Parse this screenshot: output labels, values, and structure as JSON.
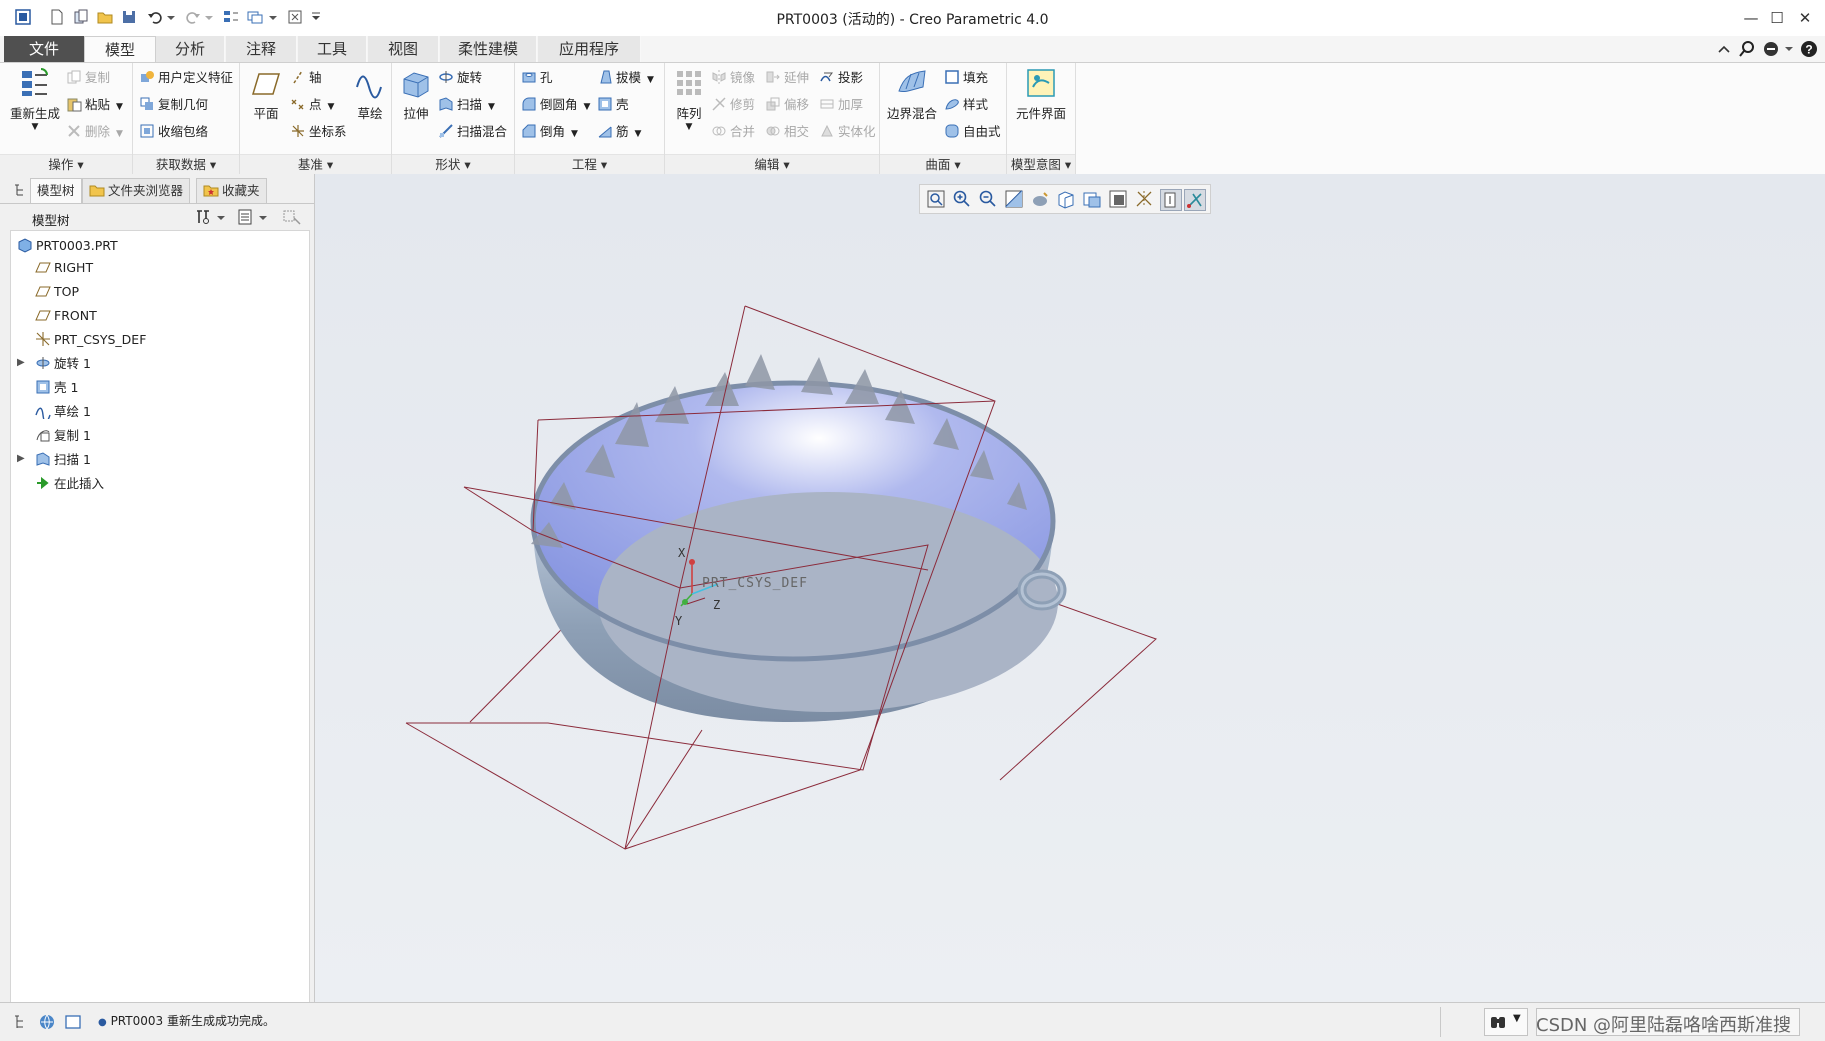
{
  "window": {
    "title": "PRT0003 (活动的) - Creo Parametric 4.0",
    "controls": [
      "—",
      "☐",
      "✕"
    ]
  },
  "tabs": [
    {
      "label": "文件"
    },
    {
      "label": "模型"
    },
    {
      "label": "分析"
    },
    {
      "label": "注释"
    },
    {
      "label": "工具"
    },
    {
      "label": "视图"
    },
    {
      "label": "柔性建模"
    },
    {
      "label": "应用程序"
    }
  ],
  "ribbon": {
    "operations": {
      "label": "操作",
      "regenerate": "重新生成",
      "copy": "复制",
      "paste": "粘贴",
      "delete": "删除"
    },
    "get_data": {
      "label": "获取数据",
      "udf": "用户定义特征",
      "copy_geom": "复制几何",
      "shrinkwrap": "收缩包络"
    },
    "datum": {
      "label": "基准",
      "plane": "平面",
      "axis": "轴",
      "point": "点",
      "csys": "坐标系",
      "sketch": "草绘"
    },
    "shapes": {
      "label": "形状",
      "extrude": "拉伸",
      "revolve": "旋转",
      "sweep": "扫描",
      "swept_blend": "扫描混合"
    },
    "engineering": {
      "label": "工程",
      "hole": "孔",
      "round": "倒圆角",
      "chamfer": "倒角",
      "draft": "拔模",
      "shell": "壳",
      "rib": "筋"
    },
    "editing": {
      "label": "编辑",
      "pattern": "阵列",
      "mirror": "镜像",
      "trim": "修剪",
      "merge": "合并",
      "extend": "延伸",
      "offset": "偏移",
      "intersect": "相交",
      "project": "投影",
      "thicken": "加厚",
      "solidify": "实体化"
    },
    "surfaces": {
      "label": "曲面",
      "boundary_blend": "边界混合",
      "fill": "填充",
      "style": "样式",
      "freestyle": "自由式"
    },
    "model_intent": {
      "label": "模型意图",
      "component_interface": "元件界面"
    }
  },
  "left_panel": {
    "tabs": [
      "模型树",
      "文件夹浏览器",
      "收藏夹"
    ],
    "header": "模型树",
    "tree": [
      {
        "label": "PRT0003.PRT"
      },
      {
        "label": "RIGHT"
      },
      {
        "label": "TOP"
      },
      {
        "label": "FRONT"
      },
      {
        "label": "PRT_CSYS_DEF"
      },
      {
        "label": "旋转 1"
      },
      {
        "label": "壳 1"
      },
      {
        "label": "草绘 1"
      },
      {
        "label": "复制 1"
      },
      {
        "label": "扫描 1"
      },
      {
        "label": "在此插入"
      }
    ]
  },
  "viewport": {
    "csys_label": "PRT_CSYS_DEF",
    "axis_x": "X",
    "axis_y": "Y",
    "axis_z": "Z"
  },
  "status": {
    "message": "PRT0003 重新生成成功完成。",
    "watermark": "CSDN @阿里陆磊咯啥西斯准搜"
  },
  "colors": {
    "bowl_inner": "#8f9ee8",
    "bowl_outer": "#8ea0b6",
    "datum_plane": "#8b2b3b",
    "file_tab": "#505050"
  }
}
